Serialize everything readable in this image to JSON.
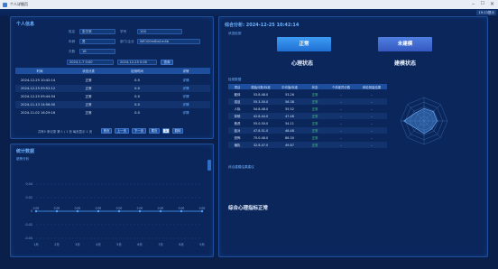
{
  "window": {
    "title": "个人详细页"
  },
  "topbar": {
    "time": "19:13提示"
  },
  "personal": {
    "title": "个人信息",
    "fields": [
      {
        "label": "姓名",
        "value": "张平采"
      },
      {
        "label": "年龄",
        "value": "男"
      },
      {
        "label": "天数",
        "value": "18"
      }
    ],
    "extra_labels": [
      "学号",
      "用户名",
      "部门/企业"
    ],
    "extra_values": [
      "100",
      "",
      "WE100m8ia1m4b"
    ],
    "date_from": "2024-1-7 0:00",
    "date_to": "2024-12-25 0:00",
    "query_label": "查询",
    "columns": [
      "时间",
      "状态分类",
      "检测时间",
      "详情"
    ],
    "rows": [
      [
        "2024-12-25 10:42:14",
        "正常",
        "0.0",
        "详情"
      ],
      [
        "2024-12-25 09:52:12",
        "正常",
        "0.0",
        "详情"
      ],
      [
        "2024-12-25 09:44:54",
        "正常",
        "0.0",
        "详情"
      ],
      [
        "2024-11-13 14:56:50",
        "正常",
        "0.0",
        "详情"
      ],
      [
        "2024-11-02 16:29:16",
        "正常",
        "0.0",
        "详情"
      ]
    ],
    "pager_text": "共有5 条记录  第 1 / 1 页  每页显示 1 页",
    "pager_buttons": [
      "首页",
      "上一页",
      "下一页",
      "尾页",
      "1",
      "跳转"
    ]
  },
  "stats": {
    "title": "统计数据",
    "subtitle": "趋势分析",
    "chart_data": {
      "type": "line",
      "categories": [
        "1月",
        "2月",
        "3月",
        "4月",
        "5月",
        "6月",
        "7月",
        "8月",
        "9月"
      ],
      "values": [
        0,
        0,
        0,
        0,
        0,
        0,
        0,
        0,
        0
      ],
      "ylabels": [
        "0.04",
        "0.02",
        "0",
        "-0.02",
        "-0.04"
      ],
      "ylim": [
        -0.04,
        0.04
      ],
      "data_labels": [
        "0.00",
        "0.00",
        "0.00",
        "0.00",
        "0.00",
        "0.00",
        "0.00",
        "0.00",
        "0.00"
      ],
      "color": "#4aa3ff"
    }
  },
  "analysis": {
    "title": "综合分析: 2024-12-25 10:42:14",
    "subtitle": "状态检测",
    "mental_button": "正常",
    "mental_label": "心理状态",
    "health_button": "未建模",
    "health_label": "建模状态",
    "detail_title": "检测数据",
    "columns": [
      "项目",
      "原始分数/标准",
      "平均值/标准",
      "状态",
      "个体差异分数",
      "体检测量结果"
    ],
    "rows": [
      [
        "躯体",
        "53.8-48.0",
        "53.26",
        "正常",
        "-",
        "-"
      ],
      [
        "强迫",
        "55.3-50.0",
        "56.38",
        "正常",
        "-",
        "-"
      ],
      [
        "人际",
        "54.8-48.0",
        "55.52",
        "正常",
        "-",
        "-"
      ],
      [
        "抑郁",
        "42.8-44.0",
        "47.48",
        "正常",
        "-",
        "-"
      ],
      [
        "焦虑",
        "55.0-50.0",
        "54.11",
        "正常",
        "-",
        "-"
      ],
      [
        "敌对",
        "47.8-51.0",
        "46.48",
        "正常",
        "-",
        "-"
      ],
      [
        "恐怖",
        "75.0-48.0",
        "86.30",
        "正常",
        "-",
        "-"
      ],
      [
        "偏执",
        "32.8-47.0",
        "49.87",
        "正常",
        "-",
        "-"
      ]
    ],
    "note_label": "综合建模结果建议",
    "conclusion": "综合心理指标正常",
    "radar_levels": 5
  }
}
